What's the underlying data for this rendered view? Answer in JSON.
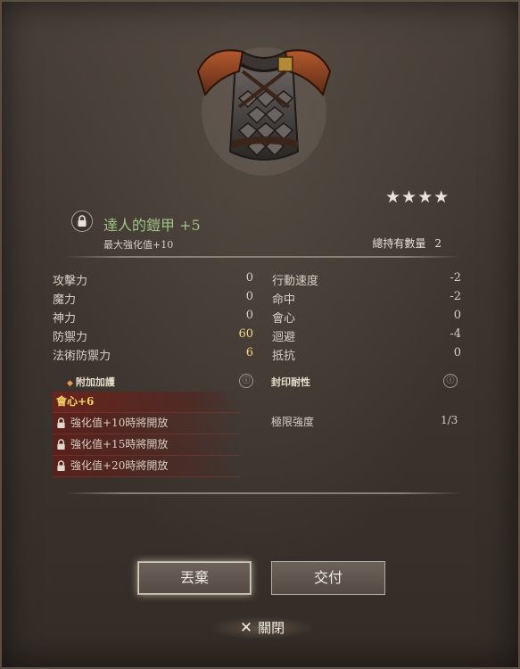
{
  "item": {
    "name": "達人的鎧甲 +5",
    "max_enhance": "最大強化值+10",
    "stars": "★★★★",
    "star_count": 4,
    "holding_label": "總持有數量",
    "holding_count": "2"
  },
  "stats_left": [
    {
      "label": "攻擊力",
      "value": "0"
    },
    {
      "label": "魔力",
      "value": "0"
    },
    {
      "label": "神力",
      "value": "0"
    },
    {
      "label": "防禦力",
      "value": "60"
    },
    {
      "label": "法術防禦力",
      "value": "6"
    }
  ],
  "stats_right": [
    {
      "label": "行動速度",
      "value": "-2"
    },
    {
      "label": "命中",
      "value": "-2"
    },
    {
      "label": "會心",
      "value": "0"
    },
    {
      "label": "迴避",
      "value": "-4"
    },
    {
      "label": "抵抗",
      "value": "0"
    }
  ],
  "bonus": {
    "title": "附加加護",
    "info_glyph": "ⓘ",
    "rows": [
      "會心+6",
      "強化值+10時將開放",
      "強化值+15時將開放",
      "強化值+20時將開放"
    ]
  },
  "seal": {
    "title": "封印耐性",
    "info_glyph": "ⓘ",
    "limit_label": "極限強度",
    "limit_value": "1/3"
  },
  "buttons": {
    "discard": "丟棄",
    "deliver": "交付",
    "close": "關閉",
    "close_glyph": "✕"
  },
  "colors": {
    "item_name": "#9fc48a",
    "highlight": "#f2d88a",
    "bonus_active": "#f2d460",
    "bonus_row_bg": "#5f1e19"
  }
}
